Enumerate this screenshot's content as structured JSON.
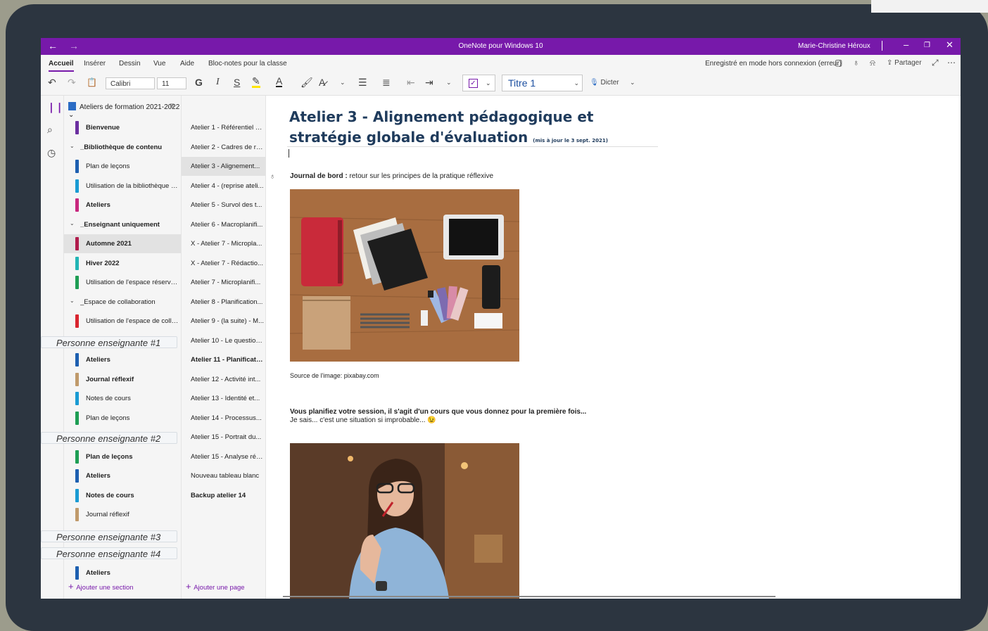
{
  "app": {
    "title": "OneNote pour Windows 10",
    "user": "Marie-Christine Héroux",
    "nav_back": "←",
    "nav_fwd": "→"
  },
  "menu": {
    "tabs": [
      "Accueil",
      "Insérer",
      "Dessin",
      "Vue",
      "Aide",
      "Bloc-notes pour la classe"
    ],
    "status": "Enregistré en mode hors connexion (erreur)",
    "share": "Partager"
  },
  "toolbar": {
    "font": "Calibri",
    "size": "11",
    "bold": "G",
    "italic": "I",
    "underline": "S",
    "font_color": "A",
    "style": "Titre 1",
    "dictate": "Dicter"
  },
  "notebook": {
    "name": "Ateliers de formation 2021-2022",
    "add_section": "Ajouter une section",
    "sections": [
      {
        "label": "Bienvenue",
        "color": "#6b2fa0",
        "bold": true
      },
      {
        "label": "_Bibliothèque de contenu",
        "group": true,
        "bold": true
      },
      {
        "label": "Plan de leçons",
        "color": "#1d5fb0"
      },
      {
        "label": "Utilisation de la bibliothèque d...",
        "color": "#1a9bd3"
      },
      {
        "label": "Ateliers",
        "color": "#c8287e",
        "bold": true
      },
      {
        "label": "_Enseignant uniquement",
        "group": true,
        "bold": true
      },
      {
        "label": "Automne 2021",
        "color": "#b01c4c",
        "bold": true,
        "selected": true
      },
      {
        "label": "Hiver 2022",
        "color": "#22b5b5",
        "bold": true
      },
      {
        "label": "Utilisation de l'espace réservé...",
        "color": "#1e9e54"
      },
      {
        "label": "_Espace de collaboration",
        "group": true
      },
      {
        "label": "Utilisation de l'espace de colla...",
        "color": "#d9252f"
      },
      {
        "label": "",
        "color": ""
      },
      {
        "label": "Ateliers",
        "color": "#1d5fb0",
        "bold": true
      },
      {
        "label": "Journal réflexif",
        "color": "#c09a6b",
        "bold": true
      },
      {
        "label": "Notes de cours",
        "color": "#1a9bd3"
      },
      {
        "label": "Plan de leçons",
        "color": "#1e9e54"
      },
      {
        "label": "",
        "color": ""
      },
      {
        "label": "Plan de leçons",
        "color": "#1e9e54",
        "bold": true
      },
      {
        "label": "Ateliers",
        "color": "#1d5fb0",
        "bold": true
      },
      {
        "label": "Notes de cours",
        "color": "#1a9bd3",
        "bold": true
      },
      {
        "label": "Journal réflexif",
        "color": "#c09a6b"
      },
      {
        "label": "",
        "color": ""
      },
      {
        "label": "",
        "color": ""
      },
      {
        "label": "Ateliers",
        "color": "#1d5fb0",
        "bold": true
      }
    ],
    "overlays": [
      "Personne enseignante #1",
      "Personne enseignante #2",
      "Personne enseignante #3",
      "Personne enseignante #4"
    ]
  },
  "pages": {
    "add_page": "Ajouter une page",
    "items": [
      {
        "label": "Atelier 1 - Référentiel d..."
      },
      {
        "label": "Atelier 2 - Cadres de ré..."
      },
      {
        "label": "Atelier 3 - Alignement...",
        "selected": true
      },
      {
        "label": "Atelier 4 - (reprise ateli..."
      },
      {
        "label": "Atelier 5 - Survol des t..."
      },
      {
        "label": "Atelier 6 - Macroplanifi..."
      },
      {
        "label": "X - Atelier 7 - Micropla..."
      },
      {
        "label": "X - Atelier 7 - Rédactio..."
      },
      {
        "label": "Atelier 7 - Microplanifi..."
      },
      {
        "label": "Atelier 8 - Planification..."
      },
      {
        "label": "Atelier 9 - (la suite) - M..."
      },
      {
        "label": "Atelier 10 - Le question..."
      },
      {
        "label": "Atelier 11 - Planificatio...",
        "bold": true
      },
      {
        "label": "Atelier 12 - Activité int..."
      },
      {
        "label": "Atelier 13 - Identité et..."
      },
      {
        "label": "Atelier 14 - Processus..."
      },
      {
        "label": "Atelier 15 - Portrait du..."
      },
      {
        "label": "Atelier 15 - Analyse réfl..."
      },
      {
        "label": "Nouveau tableau blanc"
      },
      {
        "label": "Backup atelier 14",
        "bold": true
      }
    ]
  },
  "page": {
    "title_main": "Atelier 3 - Alignement pédagogique et stratégie globale d'évaluation",
    "title_small": "(mis à jour le 3 sept. 2021)",
    "journal_label": "Journal de bord :",
    "journal_text": "retour sur les principes de la pratique réflexive",
    "source": "Source de l'image: pixabay.com",
    "para_bold": "Vous planifiez votre session, il s'agit d'un cours que vous donnez pour la première fois...",
    "para_text": "Je sais... c'est une situation si improbable...",
    "emoji": "😉"
  }
}
